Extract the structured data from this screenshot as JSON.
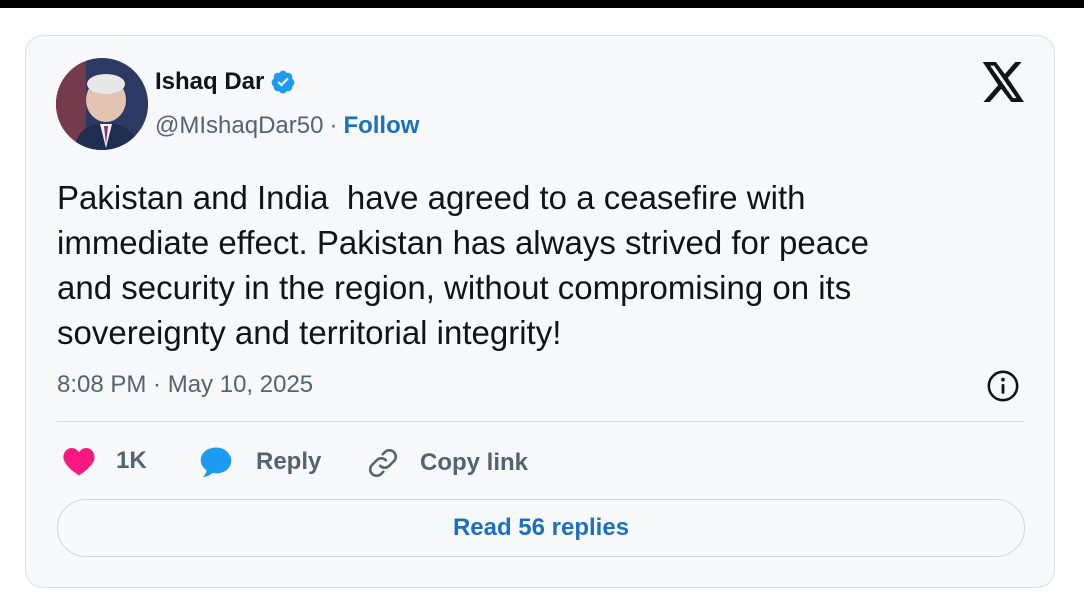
{
  "tweet": {
    "author_name": "Ishaq Dar",
    "handle": "@MIshaqDar50",
    "separator": "·",
    "follow_label": "Follow",
    "text": "Pakistan and India  have agreed to a ceasefire with\nimmediate effect. Pakistan has always strived for peace\nand security in the region, without compromising on its\nsovereignty and territorial integrity!",
    "timestamp": "8:08 PM · May 10, 2025"
  },
  "actions": {
    "likes_count": "1K",
    "reply_label": "Reply",
    "copy_link_label": "Copy link"
  },
  "read_replies_label": "Read 56 replies",
  "icons": {
    "verified": "verified-badge-icon",
    "x_logo": "x-logo-icon",
    "info": "info-icon",
    "like": "heart-icon",
    "reply": "speech-bubble-icon",
    "copy": "link-icon"
  },
  "colors": {
    "accent": "#1d6fbf",
    "verified": "#1d9bf0",
    "heart": "#f91880",
    "text": "#0f1419",
    "muted": "#536471"
  }
}
